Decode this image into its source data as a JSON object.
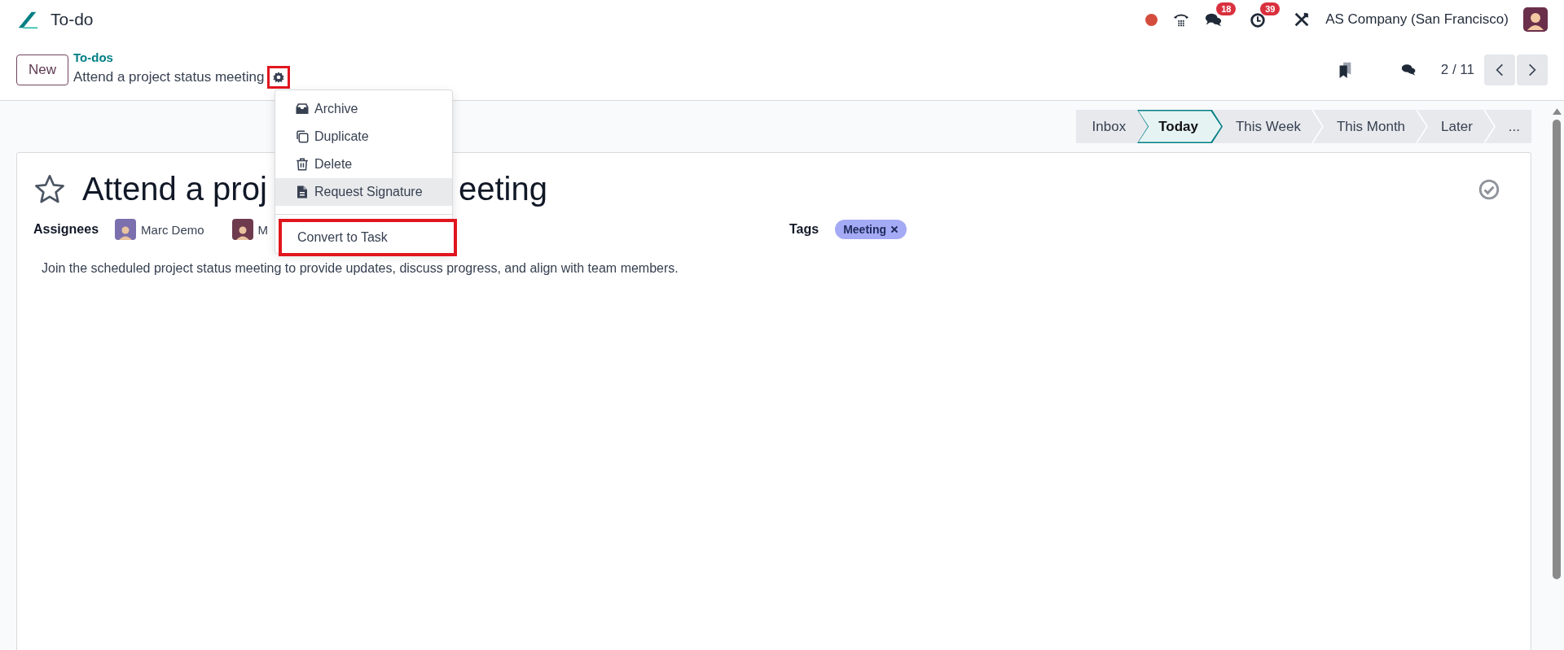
{
  "app": {
    "title": "To-do"
  },
  "systray": {
    "chat_badge": "18",
    "activity_badge": "39",
    "company": "AS Company (San Francisco)"
  },
  "control_panel": {
    "new_button": "New",
    "breadcrumb": "To-dos",
    "record_title": "Attend a project status meeting",
    "gear_outlined": true,
    "pager": "2 / 11"
  },
  "action_menu": {
    "groups": [
      [
        {
          "label": "Archive",
          "kind": "archive",
          "highlighted": false,
          "outlined": false
        },
        {
          "label": "Duplicate",
          "kind": "duplicate",
          "highlighted": false,
          "outlined": false
        },
        {
          "label": "Delete",
          "kind": "delete",
          "highlighted": false,
          "outlined": false
        },
        {
          "label": "Request Signature",
          "kind": "signature",
          "highlighted": true,
          "outlined": false
        }
      ],
      [
        {
          "label": "Convert to Task",
          "kind": "plain",
          "highlighted": false,
          "outlined": true
        }
      ]
    ]
  },
  "stages": [
    {
      "label": "Inbox",
      "selected": false
    },
    {
      "label": "Today",
      "selected": true
    },
    {
      "label": "This Week",
      "selected": false
    },
    {
      "label": "This Month",
      "selected": false
    },
    {
      "label": "Later",
      "selected": false
    },
    {
      "label": "...",
      "selected": false
    }
  ],
  "form": {
    "starred": false,
    "title_parts": [
      "Attend a proj",
      "eeting"
    ],
    "done": false,
    "assignees_label": "Assignees",
    "assignees": [
      {
        "name": "Marc Demo",
        "color": "#7b6fae"
      },
      {
        "name": "M",
        "color": "#6e3b4e"
      }
    ],
    "tags_label": "Tags",
    "tags": [
      {
        "label": "Meeting",
        "color": "#a5aaf5"
      }
    ],
    "description": "Join the scheduled project status meeting to provide updates, discuss progress, and align with team members."
  }
}
